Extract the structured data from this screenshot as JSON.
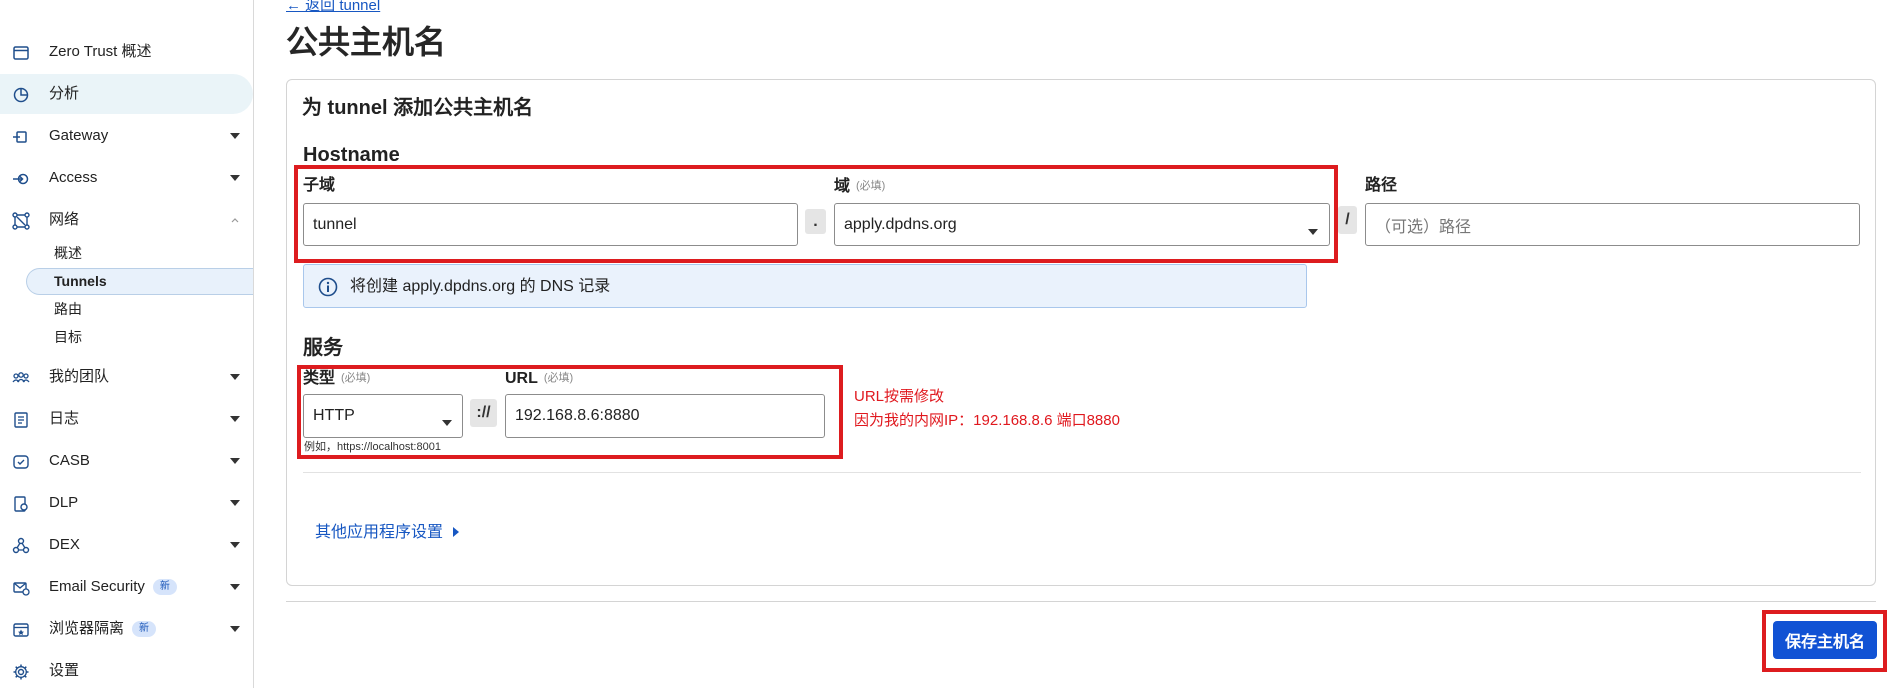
{
  "sidebar": {
    "items": [
      {
        "label": "Zero Trust 概述",
        "icon": "browser-window-icon"
      },
      {
        "label": "分析",
        "icon": "pie-chart-icon"
      },
      {
        "label": "Gateway",
        "icon": "gateway-icon"
      },
      {
        "label": "Access",
        "icon": "access-icon"
      },
      {
        "label": "网络",
        "icon": "network-icon"
      },
      {
        "label": "我的团队",
        "icon": "team-icon"
      },
      {
        "label": "日志",
        "icon": "log-icon"
      },
      {
        "label": "CASB",
        "icon": "casb-icon"
      },
      {
        "label": "DLP",
        "icon": "dlp-icon"
      },
      {
        "label": "DEX",
        "icon": "dex-icon"
      },
      {
        "label": "Email Security",
        "icon": "email-security-icon",
        "badge": "新"
      },
      {
        "label": "浏览器隔离",
        "icon": "browser-isolation-icon",
        "badge": "新"
      },
      {
        "label": "设置",
        "icon": "gear-icon"
      }
    ],
    "network_sub": [
      "概述",
      "Tunnels",
      "路由",
      "目标"
    ],
    "active_item": "分析",
    "active_sub": "Tunnels"
  },
  "header": {
    "back_link": "← 返回 tunnel",
    "title": "公共主机名"
  },
  "form": {
    "card_title": "为 tunnel 添加公共主机名",
    "hostname": {
      "section_title": "Hostname",
      "subdomain_label": "子域",
      "subdomain_value": "tunnel",
      "domain_label": "域",
      "domain_required": "(必填)",
      "domain_value": "apply.dpdns.org",
      "dot_separator": ".",
      "slash_separator": "/",
      "path_label": "路径",
      "path_placeholder": "（可选）路径",
      "info_message": "将创建 apply.dpdns.org 的 DNS 记录"
    },
    "service": {
      "section_title": "服务",
      "type_label": "类型",
      "type_required": "(必填)",
      "type_value": "HTTP",
      "scheme_separator": "://",
      "url_label": "URL",
      "url_required": "(必填)",
      "url_value": "192.168.8.6:8880",
      "hint": "例如，https://localhost:8001"
    },
    "more_settings": "其他应用程序设置"
  },
  "annotation": {
    "line1": "URL按需修改",
    "line2": "因为我的内网IP：192.168.8.6  端口8880",
    "color": "#e0181e"
  },
  "footer": {
    "save_label": "保存主机名"
  },
  "colors": {
    "accent": "#1152d4",
    "link": "#1757c2",
    "highlight_box": "#dd1c1f"
  }
}
